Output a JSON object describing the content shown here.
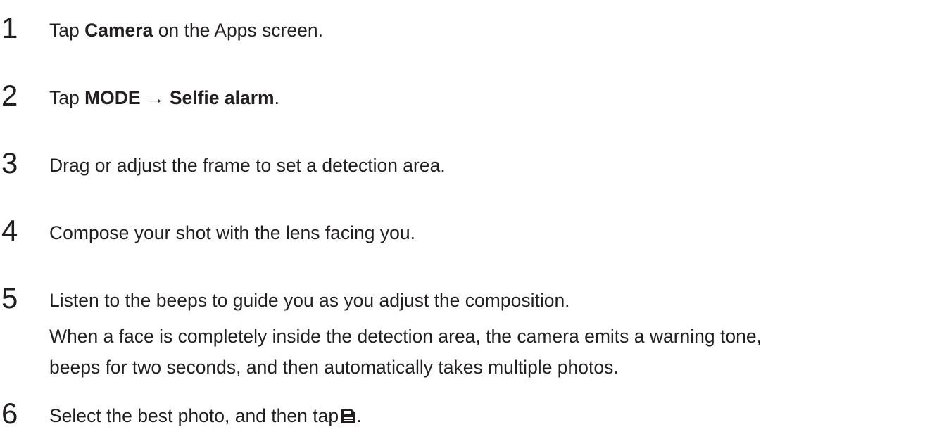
{
  "steps": [
    {
      "number": "1",
      "pre": "Tap ",
      "bold1": "Camera",
      "post": " on the Apps screen."
    },
    {
      "number": "2",
      "pre": "Tap ",
      "bold1": "MODE",
      "arrow": " → ",
      "bold2": "Selfie alarm",
      "post": "."
    },
    {
      "number": "3",
      "text": "Drag or adjust the frame to set a detection area."
    },
    {
      "number": "4",
      "text": "Compose your shot with the lens facing you."
    },
    {
      "number": "5",
      "text": "Listen to the beeps to guide you as you adjust the composition.",
      "detail_line1": "When a face is completely inside the detection area, the camera emits a warning tone,",
      "detail_line2": "beeps for two seconds, and then automatically takes multiple photos."
    },
    {
      "number": "6",
      "text": "Select the best photo, and then tap",
      "icon": "save-icon",
      "post": "."
    }
  ]
}
